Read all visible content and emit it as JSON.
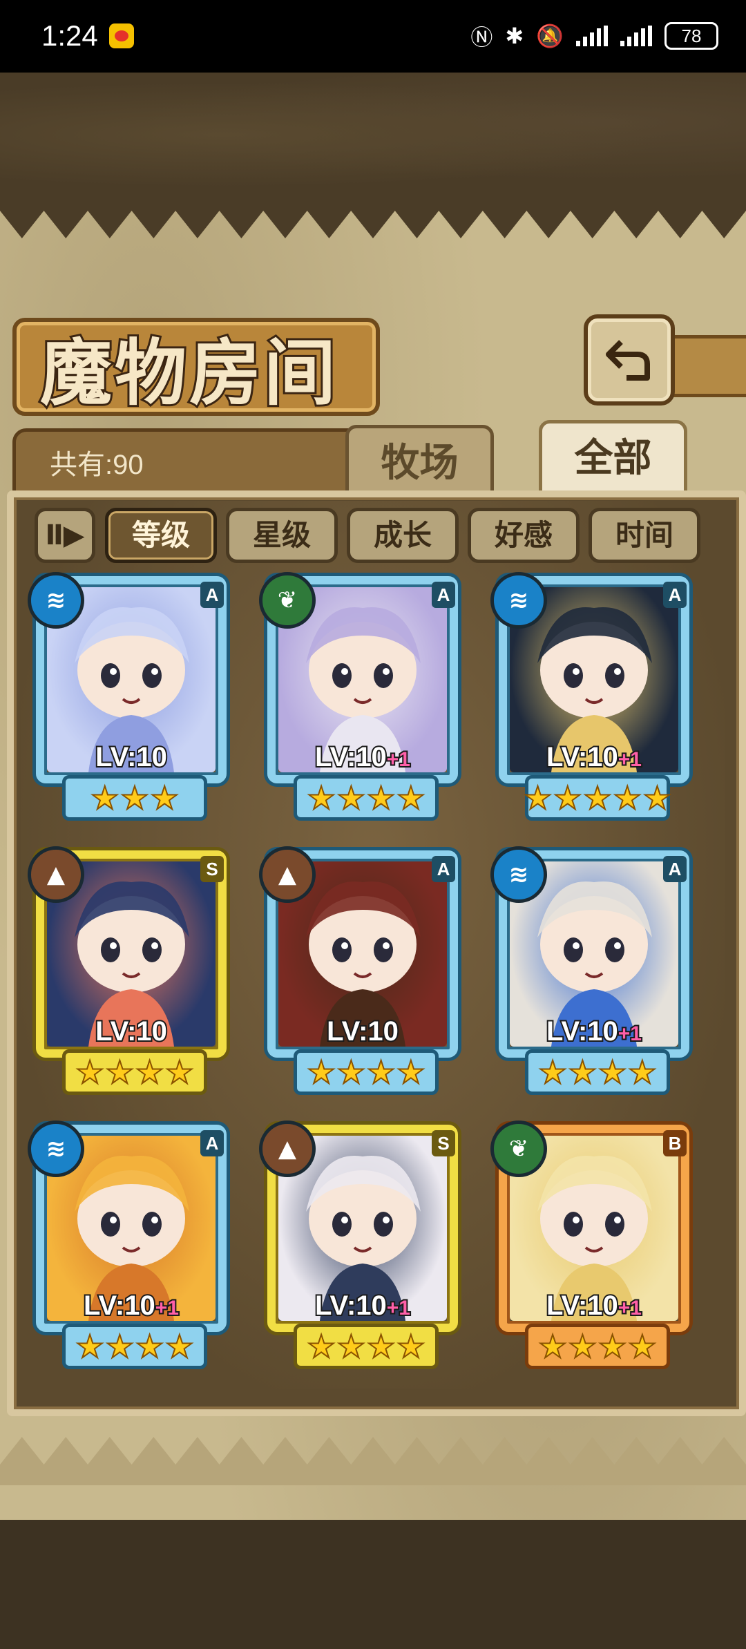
{
  "status_bar": {
    "time": "1:24",
    "battery": "78",
    "icons": [
      "weibo-icon",
      "nfc-icon",
      "bluetooth-icon",
      "mute-icon",
      "signal-icon",
      "signal-icon"
    ]
  },
  "header": {
    "title": "魔物房间",
    "back_icon": "back-arrow-icon"
  },
  "tabs": {
    "count_label": "共有:90",
    "items": [
      {
        "label": "牧场",
        "active": false
      },
      {
        "label": "全部",
        "active": true
      }
    ]
  },
  "sort_bar": {
    "toggle_label": "Ⅱ▶",
    "items": [
      {
        "label": "等级",
        "active": true
      },
      {
        "label": "星级",
        "active": false
      },
      {
        "label": "成长",
        "active": false
      },
      {
        "label": "好感",
        "active": false
      },
      {
        "label": "时间",
        "active": false
      }
    ]
  },
  "monsters": [
    {
      "rank": "A",
      "element": "water",
      "level": "LV:10",
      "bonus": "",
      "stars": 3,
      "frame": "blue",
      "colors": [
        "#c9d3f5",
        "#8f9ee0"
      ]
    },
    {
      "rank": "A",
      "element": "plant",
      "level": "LV:10",
      "bonus": "+1",
      "stars": 4,
      "frame": "blue",
      "colors": [
        "#b7abdf",
        "#e9e6f1"
      ]
    },
    {
      "rank": "A",
      "element": "water",
      "level": "LV:10",
      "bonus": "+1",
      "stars": 5,
      "frame": "blue",
      "colors": [
        "#1f2a3c",
        "#e7c66b"
      ]
    },
    {
      "rank": "S",
      "element": "earth",
      "level": "LV:10",
      "bonus": "",
      "stars": 4,
      "frame": "gold",
      "colors": [
        "#2a3a6a",
        "#e8755a"
      ]
    },
    {
      "rank": "A",
      "element": "earth",
      "level": "LV:10",
      "bonus": "",
      "stars": 4,
      "frame": "blue",
      "colors": [
        "#7a2a22",
        "#4a2a1a"
      ]
    },
    {
      "rank": "A",
      "element": "water",
      "level": "LV:10",
      "bonus": "+1",
      "stars": 4,
      "frame": "blue",
      "colors": [
        "#e5e1da",
        "#3d6fd0"
      ]
    },
    {
      "rank": "A",
      "element": "water",
      "level": "LV:10",
      "bonus": "+1",
      "stars": 4,
      "frame": "blue",
      "colors": [
        "#f4b43c",
        "#d7782a"
      ]
    },
    {
      "rank": "S",
      "element": "earth",
      "level": "LV:10",
      "bonus": "+1",
      "stars": 4,
      "frame": "gold",
      "colors": [
        "#ece9f0",
        "#2f3c5c"
      ]
    },
    {
      "rank": "B",
      "element": "plant",
      "level": "LV:10",
      "bonus": "+1",
      "stars": 4,
      "frame": "orange",
      "colors": [
        "#f3e3a8",
        "#e8c96e"
      ]
    }
  ],
  "colors": {
    "paper": "#c8b98e",
    "panel": "#5c4a2e",
    "water": "#1a82c8",
    "earth": "#7a4a2c",
    "plant": "#2f7a3a",
    "plus": "#ff5fa8"
  }
}
